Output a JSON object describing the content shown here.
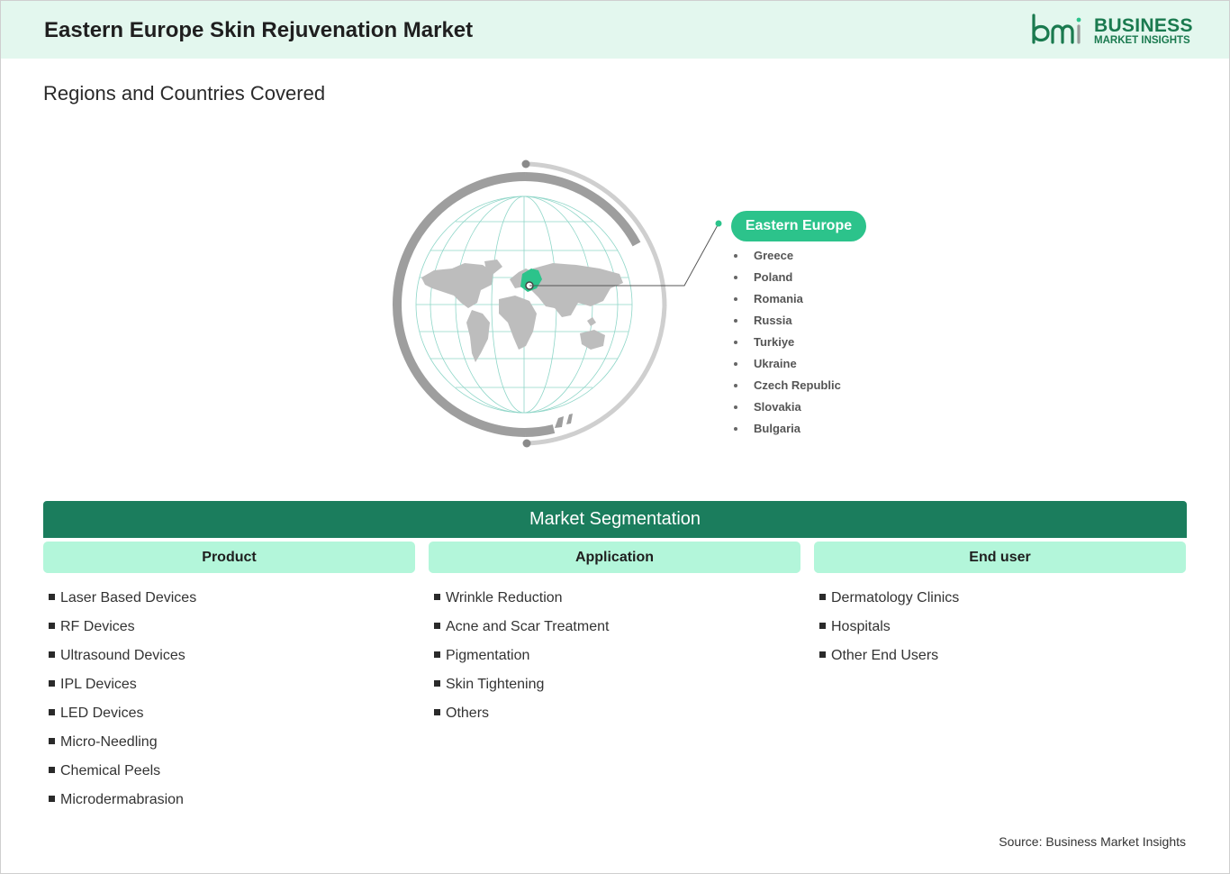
{
  "header": {
    "title": "Eastern Europe Skin Rejuvenation Market",
    "logo": {
      "line1": "BUSINESS",
      "line2": "MARKET INSIGHTS",
      "icon": "bmi-logo-icon"
    }
  },
  "regions": {
    "title": "Regions and Countries Covered",
    "region_name": "Eastern Europe",
    "countries": [
      "Greece",
      "Poland",
      "Romania",
      "Russia",
      "Turkiye",
      "Ukraine",
      "Czech Republic",
      "Slovakia",
      "Bulgaria"
    ]
  },
  "segmentation": {
    "title": "Market Segmentation",
    "columns": [
      {
        "heading": "Product",
        "items": [
          "Laser Based Devices",
          "RF Devices",
          "Ultrasound Devices",
          "IPL Devices",
          "LED Devices",
          "Micro-Needling",
          "Chemical Peels",
          "Microdermabrasion"
        ]
      },
      {
        "heading": "Application",
        "items": [
          "Wrinkle Reduction",
          "Acne and Scar Treatment",
          "Pigmentation",
          "Skin Tightening",
          "Others"
        ]
      },
      {
        "heading": "End user",
        "items": [
          "Dermatology Clinics",
          "Hospitals",
          "Other End Users"
        ]
      }
    ]
  },
  "source": "Source: Business Market Insights",
  "colors": {
    "header_bg": "#e3f7ee",
    "brand_green": "#1a7a4f",
    "accent_green": "#2cc38b",
    "seg_bar": "#1b7d5d",
    "seg_head": "#b3f6da"
  }
}
